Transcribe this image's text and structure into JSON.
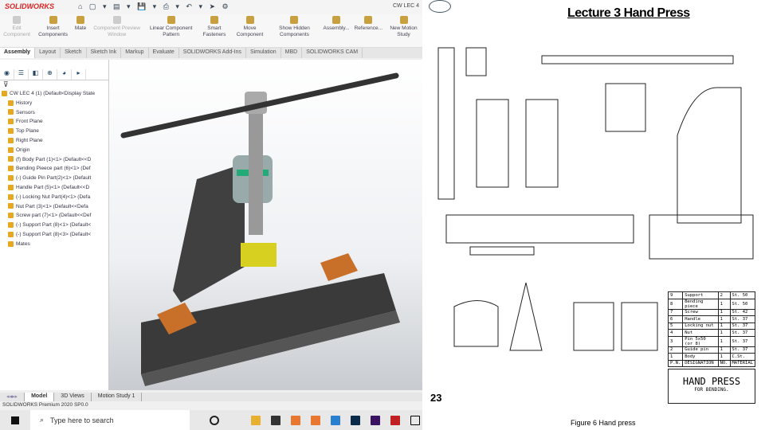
{
  "app": {
    "logo": "SOLIDWORKS",
    "doc_title": "CW LEC 4"
  },
  "ribbon": [
    {
      "label": "Edit Component",
      "disabled": true
    },
    {
      "label": "Insert Components",
      "disabled": false
    },
    {
      "label": "Mate",
      "disabled": false
    },
    {
      "label": "Component Preview Window",
      "disabled": true
    },
    {
      "label": "Linear Component Pattern",
      "disabled": false
    },
    {
      "label": "Smart Fasteners",
      "disabled": false
    },
    {
      "label": "Move Component",
      "disabled": false
    },
    {
      "label": "Show Hidden Components",
      "disabled": false
    },
    {
      "label": "Assembly...",
      "disabled": false
    },
    {
      "label": "Reference...",
      "disabled": false
    },
    {
      "label": "New Motion Study",
      "disabled": false
    }
  ],
  "tabs": [
    "Assembly",
    "Layout",
    "Sketch",
    "Sketch Ink",
    "Markup",
    "Evaluate",
    "SOLIDWORKS Add-Ins",
    "Simulation",
    "MBD",
    "SOLIDWORKS CAM"
  ],
  "tree": [
    "CW LEC 4 (1) (Default<Display State",
    "History",
    "Sensors",
    "Front Plane",
    "Top Plane",
    "Right Plane",
    "Origin",
    "(f) Body Part (1)<1> (Default<<D",
    "Bending Pieece part (6)<1> (Def",
    "(-) Guide Pin Part(2)<1> (Default",
    "Handle Part (5)<1> (Default<<D",
    "(-) Locking Nut Part(4)<1> (Defa",
    "Nut Part (3)<1> (Default<<Defa",
    "Screw part (7)<1> (Default<<Def",
    "(-) Support Part (8)<1> (Default<",
    "(-) Support Part (8)<3> (Default<",
    "Mates"
  ],
  "bottom_tabs": [
    "Model",
    "3D Views",
    "Motion Study 1"
  ],
  "status": "SOLIDWORKS Premium 2020 SP0.0",
  "taskbar": {
    "search_placeholder": "Type here to search"
  },
  "doc": {
    "title": "Lecture 3 Hand Press",
    "page": "23",
    "caption": "Figure 6 Hand press",
    "bom": [
      [
        "9",
        "Support",
        "2",
        "St. 50"
      ],
      [
        "8",
        "Bending piece",
        "1",
        "St. 50"
      ],
      [
        "7",
        "Screw",
        "1",
        "St. 42"
      ],
      [
        "6",
        "Handle",
        "1",
        "St. 37"
      ],
      [
        "5",
        "Locking nut",
        "1",
        "St. 37"
      ],
      [
        "4",
        "Nut",
        "1",
        "St. 37"
      ],
      [
        "3",
        "Pin 5x50 (or 8)",
        "1",
        "St. 37"
      ],
      [
        "2",
        "Guide pin",
        "1",
        "St. 37"
      ],
      [
        "1",
        "Body",
        "1",
        "C.St."
      ],
      [
        "P.N.",
        "DESIGNATION",
        "NO.",
        "MATERIAL"
      ]
    ],
    "title_block": "HAND PRESS",
    "subtitle": "FOR BENDING."
  }
}
